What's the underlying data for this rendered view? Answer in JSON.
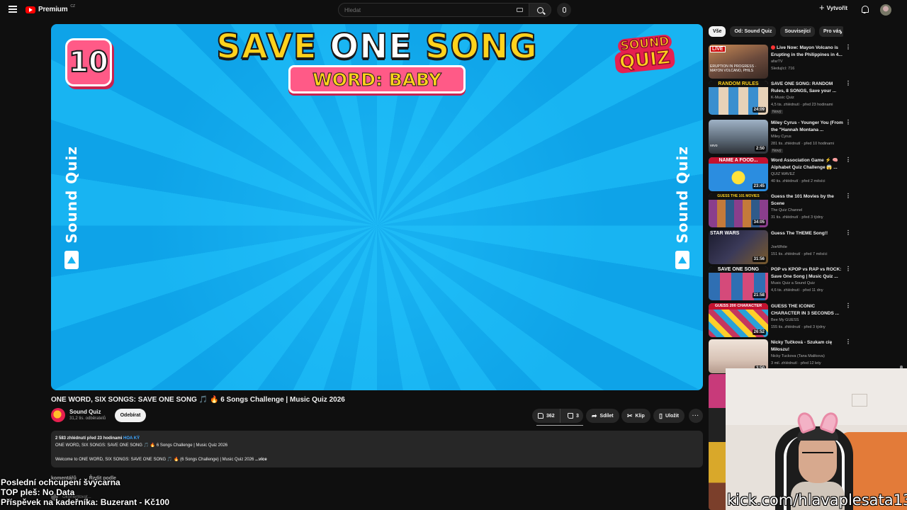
{
  "header": {
    "logo_text": "Premium",
    "logo_region": "CZ",
    "search_placeholder": "Hledat",
    "create_label": "Vytvořit"
  },
  "player": {
    "title_left": "SAVE ",
    "title_mid": "ONE",
    "title_right": " SONG",
    "word_banner": "WORD: BABY",
    "counter": "10",
    "logo_line1": "SOUND",
    "logo_line2": "QUIZ",
    "side_text": "Sound Quiz"
  },
  "video": {
    "title": "ONE WORD, SIX SONGS: SAVE ONE SONG 🎵 🔥 6 Songs Challenge | Music Quiz 2026",
    "channel_name": "Sound Quiz",
    "subscribers": "31,2 tis. odběratelů",
    "subscribe_label": "Odebírat",
    "likes": "362",
    "dislikes": "3",
    "share_label": "Sdílet",
    "clip_label": "Klip",
    "save_label": "Uložit",
    "more_label": "···"
  },
  "description": {
    "meta": "2 583 zhlédnutí  před 23 hodinami",
    "tag": "HOA KỲ",
    "line1": "ONE WORD, SIX SONGS: SAVE ONE SONG 🎵 🔥 6 Songs Challenge | Music Quiz 2026",
    "line2": "Welcome to ONE WORD, SIX SONGS: SAVE ONE SONG 🎵 🔥 (6 Songs Challenge) | Music Quiz 2026",
    "more": "...více"
  },
  "comments": {
    "count_label": "komentářů",
    "sort_label": "Řadit podle",
    "input_placeholder": "Okomentovat..."
  },
  "overlay": {
    "line1": "Poslední ochcupení švýcarna",
    "line2": "TOP pleš: No Data",
    "line3": "Příspěvek na kadeřníka: Buzerant - Kč100",
    "kick_url": "kick.com/hlavaplesata13"
  },
  "chips": [
    "Vše",
    "Od: Sound Quiz",
    "Související",
    "Pro vás"
  ],
  "recommendations": [
    {
      "title": "Live Now: Mayon Volcano is Erupting in the Philippines in 4...",
      "channel": "afarTV",
      "stats": "Sledující: 716",
      "duration": "",
      "badge": "",
      "live": true,
      "thumb_label": "LIVE",
      "thumb_caption": "ERUPTION IN PROGRESS · MAYON VOLCANO, PHILS",
      "thumb_color": "#6b4a3c"
    },
    {
      "title": "SAVE ONE SONG: RANDOM Rules, 8 SONGS, Save your ...",
      "channel": "K-Music Quiz",
      "stats": "4,5 tis. zhlédnutí · před 23 hodinami",
      "duration": "24:09",
      "badge": "Nový",
      "live": false,
      "thumb_label": "RANDOM RULES",
      "thumb_caption": "",
      "thumb_color": "#4aa6d9"
    },
    {
      "title": "Miley Cyrus - Younger You (From the \"Hannah Montana ...",
      "channel": "Miley Cyrus",
      "stats": "281 tis. zhlédnutí · před 10 hodinami",
      "duration": "2:50",
      "badge": "Nový",
      "live": false,
      "thumb_label": "",
      "thumb_caption": "vevo",
      "thumb_color": "#7e8fa3"
    },
    {
      "title": "Word Association Game ⚡ 🧠 Alphabet Quiz Challenge 😱 ...",
      "channel": "QUIZ WAVEZ",
      "stats": "40 tis. zhlédnutí · před 2 měsíci",
      "duration": "23:45",
      "badge": "",
      "live": false,
      "thumb_label": "NAME A FOOD...",
      "thumb_caption": "",
      "thumb_color": "#2b8de0"
    },
    {
      "title": "Guess the 101 Movies by the Scene",
      "channel": "The Quiz Channel",
      "stats": "31 tis. zhlédnutí · před 3 týdny",
      "duration": "34:05",
      "badge": "",
      "live": false,
      "thumb_label": "GUESS THE 101 MOVIES",
      "thumb_caption": "",
      "thumb_color": "#8a3e8c"
    },
    {
      "title": "Guess The THEME Song!!",
      "channel": "JoeWhite",
      "stats": "151 tis. zhlédnutí · před 7 měsíci",
      "duration": "31:56",
      "badge": "",
      "live": false,
      "thumb_label": "STAR WARS",
      "thumb_caption": "",
      "thumb_color": "#3b3a59"
    },
    {
      "title": "POP vs KPOP vs RAP vs ROCK: Save One Song | Music Quiz ...",
      "channel": "Music Quiz a Sound Quiz",
      "stats": "4,6 tis. zhlédnutí · před 11 dny",
      "duration": "21:58",
      "badge": "",
      "live": false,
      "thumb_label": "SAVE ONE SONG",
      "thumb_caption": "",
      "thumb_color": "#2f6fb3"
    },
    {
      "title": "GUESS THE ICONIC CHARACTER IN 3 SECONDS ...",
      "channel": "Bee My GUESS",
      "stats": "155 tis. zhlédnutí · před 3 týdny",
      "duration": "26:52",
      "badge": "",
      "live": false,
      "thumb_label": "GUESS 200 CHARACTER",
      "thumb_caption": "",
      "thumb_color": "#c4365f"
    },
    {
      "title": "Nicky Tučková - Szukam cię Miłoszu!",
      "channel": "Nicky Tuckova (Tana Malikova)",
      "stats": "3 mil. zhlédnutí · před 12 lety",
      "duration": "3:50",
      "badge": "",
      "live": false,
      "thumb_label": "",
      "thumb_caption": "",
      "thumb_color": "#d8c3b6"
    }
  ]
}
